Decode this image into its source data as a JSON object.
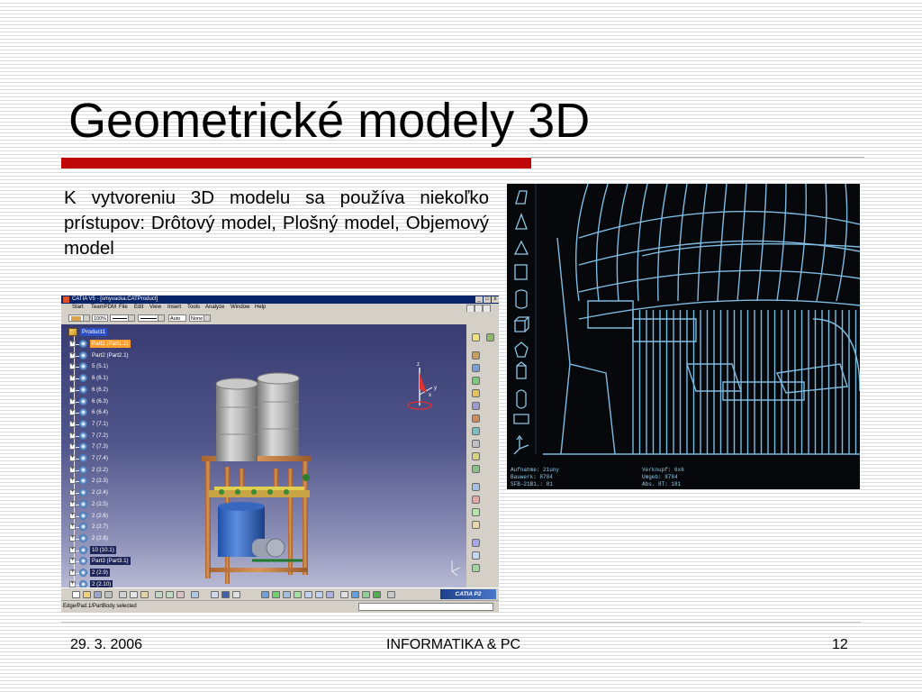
{
  "slide": {
    "title": "Geometrické modely 3D",
    "body": "K vytvoreniu 3D modelu sa používa niekoľko prístupov: Drôtový model, Plošný model, Objemový model",
    "footer": {
      "date": "29. 3. 2006",
      "center": "INFORMATIKA & PC",
      "page": "12"
    },
    "accent_color": "#c0070a"
  },
  "catia": {
    "window_title": "CATIA V5 - [smyvacka.CATProduct]",
    "window_buttons": [
      "_",
      "□",
      "x"
    ],
    "menu": [
      "Start",
      "TeamPDM",
      "File",
      "Edit",
      "View",
      "Insert",
      "Tools",
      "Analyze",
      "Window",
      "Help"
    ],
    "toolbar": {
      "color": "",
      "line_width": "100%",
      "line_type": "",
      "thickness": "",
      "layer_auto": "Auto",
      "layer_none": "None"
    },
    "tree": {
      "root": "Product1",
      "nodes": [
        {
          "label": "Part1 (Part1.1)",
          "style": "highlight"
        },
        {
          "label": "Part2 (Part2.1)",
          "style": "normal"
        },
        {
          "label": "5 (5.1)",
          "style": "normal"
        },
        {
          "label": "6 (6.1)",
          "style": "normal"
        },
        {
          "label": "6 (6.2)",
          "style": "normal"
        },
        {
          "label": "6 (6.3)",
          "style": "normal"
        },
        {
          "label": "6 (6.4)",
          "style": "normal"
        },
        {
          "label": "7 (7.1)",
          "style": "normal"
        },
        {
          "label": "7 (7.2)",
          "style": "normal"
        },
        {
          "label": "7 (7.3)",
          "style": "normal"
        },
        {
          "label": "7 (7.4)",
          "style": "normal"
        },
        {
          "label": "2 (2.2)",
          "style": "normal"
        },
        {
          "label": "2 (2.3)",
          "style": "normal"
        },
        {
          "label": "2 (2.4)",
          "style": "normal"
        },
        {
          "label": "2 (2.5)",
          "style": "normal"
        },
        {
          "label": "2 (2.6)",
          "style": "normal"
        },
        {
          "label": "2 (2.7)",
          "style": "normal"
        },
        {
          "label": "2 (2.8)",
          "style": "normal"
        },
        {
          "label": "10 (10.1)",
          "style": "dark"
        },
        {
          "label": "Part3 (Part3.1)",
          "style": "dark"
        },
        {
          "label": "2 (2.9)",
          "style": "dark"
        },
        {
          "label": "2 (2.10)",
          "style": "dark"
        }
      ]
    },
    "compass": {
      "z": "z",
      "y": "y",
      "x": "x"
    },
    "logo": "CATIA P2",
    "status_text": "Edge/Pad.1/PartBody selected"
  },
  "wireframe": {
    "info": [
      "Aufnahme: 21uny",
      "Bauwerk: 8784",
      "SFB-21B1.: 81",
      "Verknupf: 6x6",
      "Umgeb: 8784",
      "Abs. 8T: 181"
    ]
  }
}
